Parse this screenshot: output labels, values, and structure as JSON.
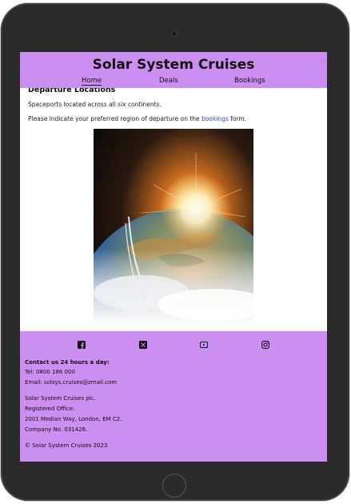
{
  "site": {
    "title": "Solar System Cruises"
  },
  "nav": {
    "items": [
      "Home",
      "Deals",
      "Bookings"
    ],
    "active": "Home"
  },
  "main": {
    "heading": "Departure Locations",
    "para1": "Spaceports located across all six continents.",
    "para2_prefix": "Please indicate your preferred region of departure on the ",
    "para2_link": "bookings",
    "para2_suffix": " form."
  },
  "footer": {
    "social_icons": [
      "facebook-icon",
      "x-icon",
      "youtube-icon",
      "instagram-icon"
    ],
    "contact_heading": "Contact us 24 hours a day:",
    "tel": "Tel: 0800 186 000",
    "email": "Email: solsys.cruises@zmail.com",
    "company": "Solar System Cruises plc.",
    "registered": "Registered Office:",
    "address": "2001 Median Way, London, EM C2.",
    "company_no": "Company No. 031426.",
    "copyright": "© Solar System Cruises 2023"
  },
  "colors": {
    "accent": "#cc8ef0",
    "link": "#3344cc",
    "device": "#2a2a2a"
  }
}
